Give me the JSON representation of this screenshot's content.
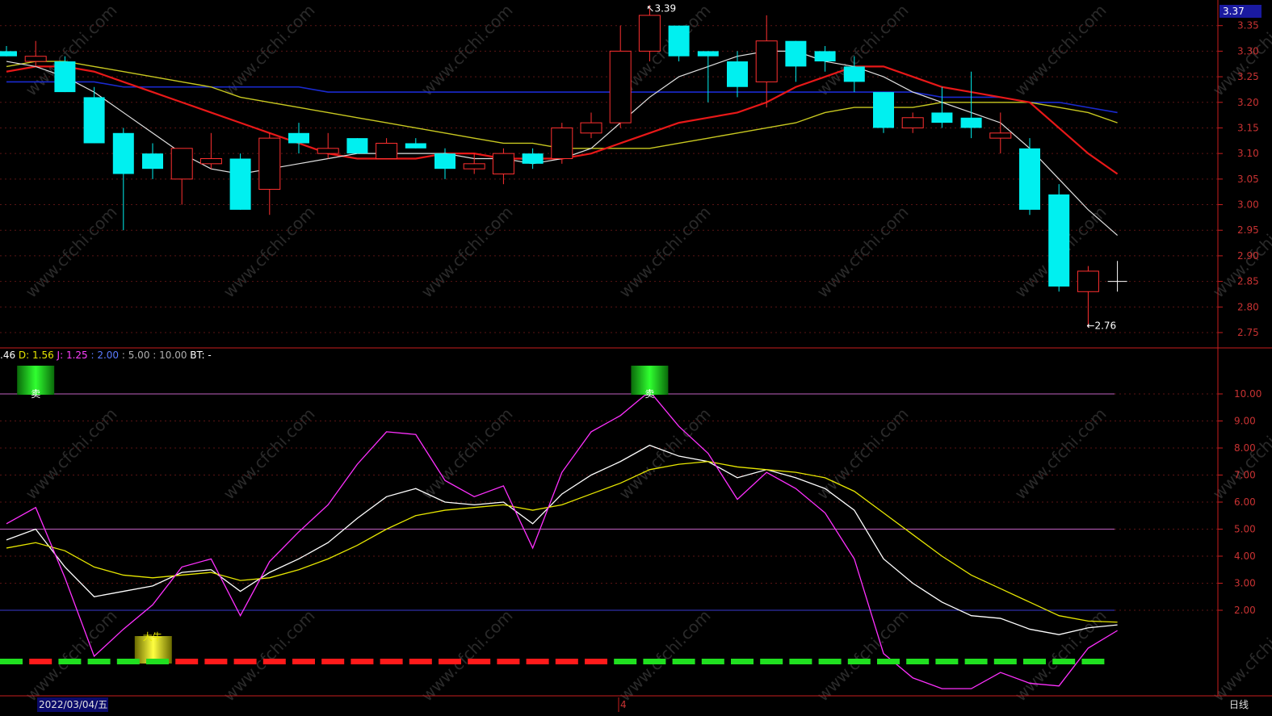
{
  "chart_data": [
    {
      "type": "candlestick",
      "ylim": [
        2.72,
        3.4
      ],
      "yticks": [
        "3.35",
        "3.30",
        "3.25",
        "3.20",
        "3.15",
        "3.10",
        "3.05",
        "3.00",
        "2.95",
        "2.90",
        "2.85",
        "2.80",
        "2.75"
      ],
      "current_price": "3.37",
      "candles": [
        {
          "o": 3.3,
          "h": 3.31,
          "l": 3.29,
          "c": 3.29
        },
        {
          "o": 3.28,
          "h": 3.32,
          "l": 3.27,
          "c": 3.29
        },
        {
          "o": 3.28,
          "h": 3.29,
          "l": 3.22,
          "c": 3.22
        },
        {
          "o": 3.21,
          "h": 3.23,
          "l": 3.12,
          "c": 3.12
        },
        {
          "o": 3.14,
          "h": 3.15,
          "l": 2.95,
          "c": 3.06
        },
        {
          "o": 3.1,
          "h": 3.12,
          "l": 3.05,
          "c": 3.07
        },
        {
          "o": 3.05,
          "h": 3.11,
          "l": 3.0,
          "c": 3.11
        },
        {
          "o": 3.08,
          "h": 3.14,
          "l": 3.07,
          "c": 3.09
        },
        {
          "o": 3.09,
          "h": 3.1,
          "l": 2.99,
          "c": 2.99
        },
        {
          "o": 3.03,
          "h": 3.14,
          "l": 2.98,
          "c": 3.13
        },
        {
          "o": 3.14,
          "h": 3.16,
          "l": 3.1,
          "c": 3.12
        },
        {
          "o": 3.1,
          "h": 3.14,
          "l": 3.09,
          "c": 3.11
        },
        {
          "o": 3.13,
          "h": 3.13,
          "l": 3.1,
          "c": 3.1
        },
        {
          "o": 3.09,
          "h": 3.13,
          "l": 3.09,
          "c": 3.12
        },
        {
          "o": 3.12,
          "h": 3.13,
          "l": 3.11,
          "c": 3.11
        },
        {
          "o": 3.1,
          "h": 3.11,
          "l": 3.05,
          "c": 3.07
        },
        {
          "o": 3.07,
          "h": 3.1,
          "l": 3.06,
          "c": 3.08
        },
        {
          "o": 3.06,
          "h": 3.11,
          "l": 3.04,
          "c": 3.1
        },
        {
          "o": 3.1,
          "h": 3.11,
          "l": 3.07,
          "c": 3.08
        },
        {
          "o": 3.09,
          "h": 3.16,
          "l": 3.08,
          "c": 3.15
        },
        {
          "o": 3.14,
          "h": 3.18,
          "l": 3.13,
          "c": 3.16
        },
        {
          "o": 3.16,
          "h": 3.35,
          "l": 3.15,
          "c": 3.3
        },
        {
          "o": 3.3,
          "h": 3.39,
          "l": 3.28,
          "c": 3.37
        },
        {
          "o": 3.35,
          "h": 3.35,
          "l": 3.28,
          "c": 3.29
        },
        {
          "o": 3.3,
          "h": 3.3,
          "l": 3.2,
          "c": 3.29
        },
        {
          "o": 3.28,
          "h": 3.3,
          "l": 3.21,
          "c": 3.23
        },
        {
          "o": 3.24,
          "h": 3.37,
          "l": 3.19,
          "c": 3.32
        },
        {
          "o": 3.32,
          "h": 3.32,
          "l": 3.24,
          "c": 3.27
        },
        {
          "o": 3.3,
          "h": 3.31,
          "l": 3.26,
          "c": 3.28
        },
        {
          "o": 3.27,
          "h": 3.29,
          "l": 3.22,
          "c": 3.24
        },
        {
          "o": 3.22,
          "h": 3.22,
          "l": 3.14,
          "c": 3.15
        },
        {
          "o": 3.15,
          "h": 3.18,
          "l": 3.14,
          "c": 3.17
        },
        {
          "o": 3.18,
          "h": 3.23,
          "l": 3.15,
          "c": 3.16
        },
        {
          "o": 3.17,
          "h": 3.26,
          "l": 3.13,
          "c": 3.15
        },
        {
          "o": 3.13,
          "h": 3.18,
          "l": 3.1,
          "c": 3.14
        },
        {
          "o": 3.11,
          "h": 3.13,
          "l": 2.98,
          "c": 2.99
        },
        {
          "o": 3.02,
          "h": 3.04,
          "l": 2.83,
          "c": 2.84
        },
        {
          "o": 2.83,
          "h": 2.88,
          "l": 2.76,
          "c": 2.87
        },
        {
          "o": 2.85,
          "h": 2.89,
          "l": 2.83,
          "c": 2.85
        }
      ],
      "ma_white": [
        3.28,
        3.27,
        3.25,
        3.22,
        3.18,
        3.14,
        3.1,
        3.07,
        3.06,
        3.07,
        3.08,
        3.09,
        3.1,
        3.1,
        3.1,
        3.1,
        3.09,
        3.09,
        3.08,
        3.09,
        3.11,
        3.16,
        3.21,
        3.25,
        3.27,
        3.29,
        3.3,
        3.3,
        3.28,
        3.27,
        3.25,
        3.22,
        3.2,
        3.18,
        3.16,
        3.11,
        3.05,
        2.99,
        2.94
      ],
      "ma_red": [
        3.26,
        3.27,
        3.27,
        3.26,
        3.24,
        3.22,
        3.2,
        3.18,
        3.16,
        3.14,
        3.12,
        3.1,
        3.09,
        3.09,
        3.09,
        3.1,
        3.1,
        3.09,
        3.09,
        3.09,
        3.1,
        3.12,
        3.14,
        3.16,
        3.17,
        3.18,
        3.2,
        3.23,
        3.25,
        3.27,
        3.27,
        3.25,
        3.23,
        3.22,
        3.21,
        3.2,
        3.15,
        3.1,
        3.06
      ],
      "ma_yellow": [
        3.27,
        3.28,
        3.28,
        3.27,
        3.26,
        3.25,
        3.24,
        3.23,
        3.21,
        3.2,
        3.19,
        3.18,
        3.17,
        3.16,
        3.15,
        3.14,
        3.13,
        3.12,
        3.12,
        3.11,
        3.11,
        3.11,
        3.11,
        3.12,
        3.13,
        3.14,
        3.15,
        3.16,
        3.18,
        3.19,
        3.19,
        3.19,
        3.2,
        3.2,
        3.2,
        3.2,
        3.19,
        3.18,
        3.16
      ],
      "ma_blue": [
        3.24,
        3.24,
        3.24,
        3.24,
        3.23,
        3.23,
        3.23,
        3.23,
        3.23,
        3.23,
        3.23,
        3.22,
        3.22,
        3.22,
        3.22,
        3.22,
        3.22,
        3.22,
        3.22,
        3.22,
        3.22,
        3.22,
        3.22,
        3.22,
        3.22,
        3.22,
        3.22,
        3.22,
        3.22,
        3.22,
        3.22,
        3.22,
        3.21,
        3.21,
        3.21,
        3.2,
        3.2,
        3.19,
        3.18
      ],
      "high_label": "3.39",
      "low_label": "2.76"
    },
    {
      "type": "line",
      "header": [
        {
          "text": ".46",
          "color": "#ffffff"
        },
        {
          "text": "D: 1.56",
          "color": "#e6e600"
        },
        {
          "text": "J: 1.25",
          "color": "#ff40ff"
        },
        {
          "text": ": 2.00",
          "color": "#5a7aff"
        },
        {
          "text": ": 5.00",
          "color": "#b0b0b0"
        },
        {
          "text": ": 10.00",
          "color": "#b0b0b0"
        },
        {
          "text": "BT: -",
          "color": "#ffffff"
        }
      ],
      "ylim": [
        0,
        11
      ],
      "yticks": [
        "10.00",
        "9.00",
        "8.00",
        "7.00",
        "6.00",
        "5.00",
        "4.00",
        "3.00",
        "2.00"
      ],
      "ref_lines": [
        {
          "y": 10,
          "color": "#c060c0"
        },
        {
          "y": 5,
          "color": "#c060c0"
        },
        {
          "y": 2,
          "color": "#3a3ad0"
        }
      ],
      "series": [
        {
          "color": "#ffffff",
          "values": [
            4.6,
            5.0,
            3.6,
            2.5,
            2.7,
            2.9,
            3.4,
            3.5,
            2.7,
            3.4,
            3.9,
            4.5,
            5.4,
            6.2,
            6.5,
            6.0,
            5.9,
            6.0,
            5.2,
            6.3,
            7.0,
            7.5,
            8.1,
            7.7,
            7.5,
            6.9,
            7.2,
            6.9,
            6.5,
            5.7,
            3.9,
            3.0,
            2.3,
            1.8,
            1.7,
            1.3,
            1.1,
            1.35,
            1.46
          ]
        },
        {
          "color": "#e6e600",
          "values": [
            4.3,
            4.5,
            4.2,
            3.6,
            3.3,
            3.2,
            3.3,
            3.4,
            3.1,
            3.2,
            3.5,
            3.9,
            4.4,
            5.0,
            5.5,
            5.7,
            5.8,
            5.9,
            5.7,
            5.9,
            6.3,
            6.7,
            7.2,
            7.4,
            7.5,
            7.3,
            7.2,
            7.1,
            6.9,
            6.4,
            5.6,
            4.8,
            4.0,
            3.3,
            2.8,
            2.3,
            1.8,
            1.6,
            1.56
          ]
        },
        {
          "color": "#ff30ff",
          "values": [
            5.2,
            5.8,
            3.2,
            0.3,
            1.3,
            2.2,
            3.6,
            3.9,
            1.8,
            3.8,
            4.9,
            5.9,
            7.4,
            8.6,
            8.5,
            6.8,
            6.2,
            6.6,
            4.3,
            7.1,
            8.6,
            9.2,
            10.1,
            8.8,
            7.8,
            6.1,
            7.1,
            6.5,
            5.6,
            3.9,
            0.4,
            -0.5,
            -0.9,
            -0.9,
            -0.3,
            -0.7,
            -0.8,
            0.6,
            1.25
          ]
        }
      ],
      "signals": [
        {
          "index": 1,
          "text": "卖",
          "kind": "sell"
        },
        {
          "index": 22,
          "text": "卖",
          "kind": "sell"
        },
        {
          "index": 4,
          "text": "大牛",
          "kind": "bull"
        }
      ],
      "state_bar": [
        "g",
        "r",
        "g",
        "g",
        "g",
        "g",
        "r",
        "r",
        "r",
        "r",
        "r",
        "r",
        "r",
        "r",
        "r",
        "r",
        "r",
        "r",
        "r",
        "r",
        "r",
        "g",
        "g",
        "g",
        "g",
        "g",
        "g",
        "g",
        "g",
        "g",
        "g",
        "g",
        "g",
        "g",
        "g",
        "g",
        "g",
        "g"
      ]
    }
  ],
  "footer": {
    "date": "2022/03/04/五",
    "marker": "4",
    "period": "日线"
  },
  "watermark": "www.cfchi.com"
}
